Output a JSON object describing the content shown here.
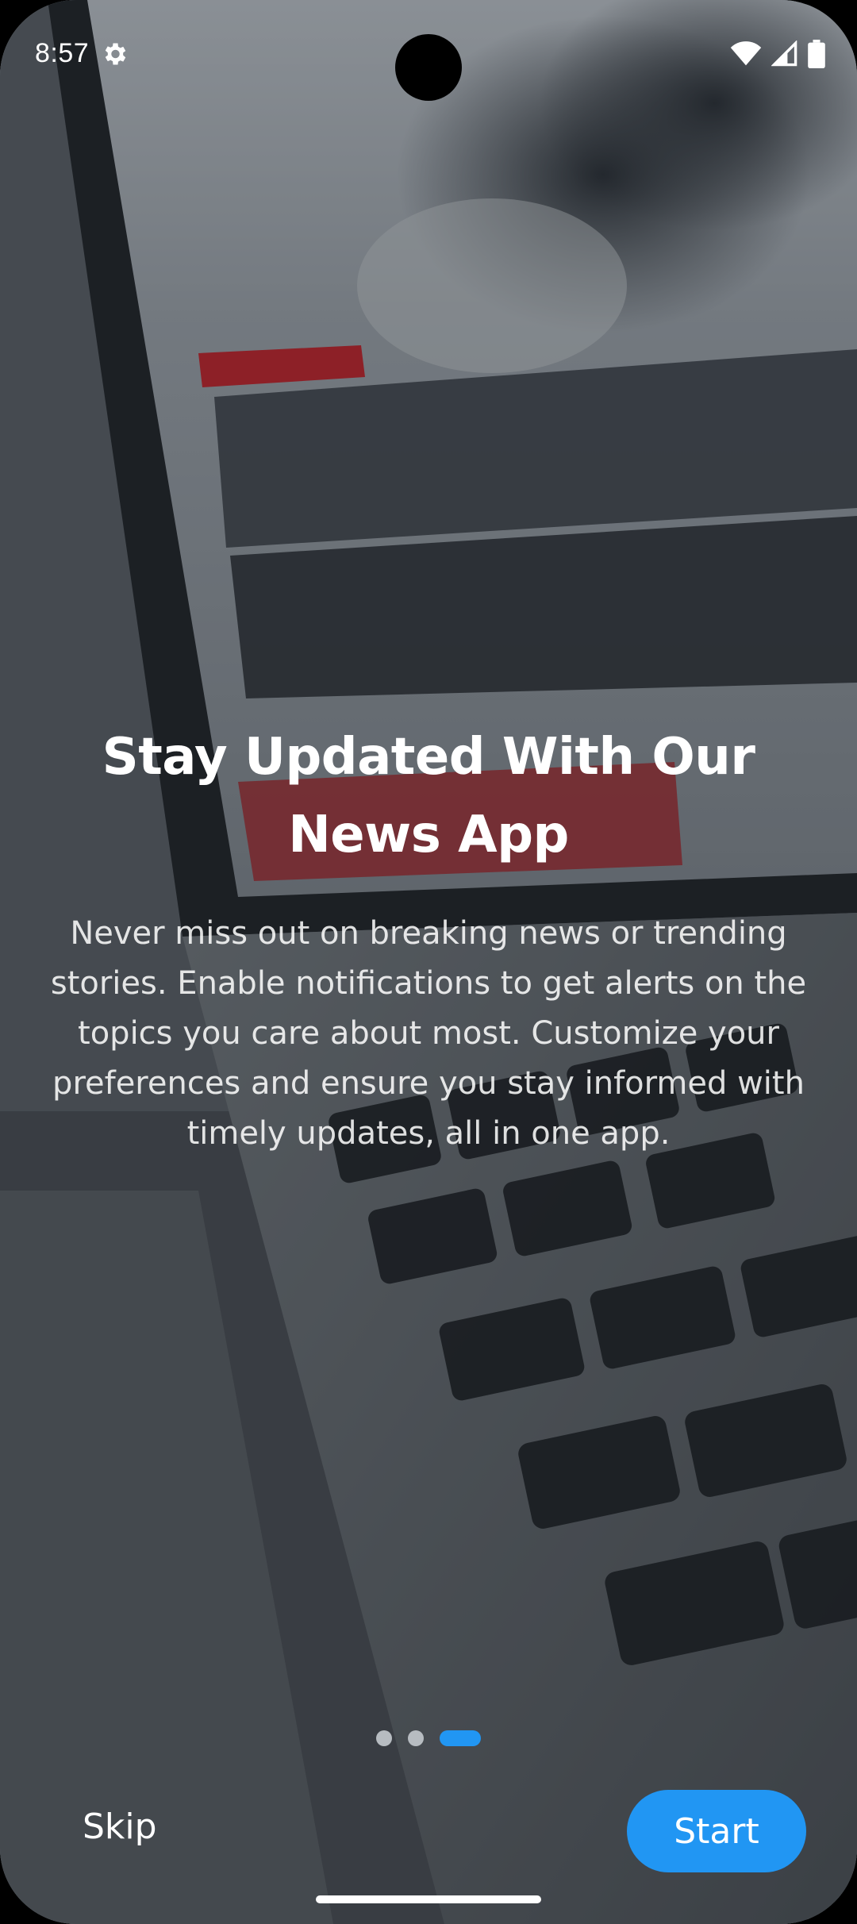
{
  "status_bar": {
    "time": "8:57",
    "icons": [
      "gear-icon",
      "wifi-icon",
      "signal-icon",
      "battery-icon"
    ]
  },
  "onboarding": {
    "title": "Stay Updated With Our News App",
    "description": "Never miss out on breaking news or trending stories. Enable notifications to get alerts on the topics you care about most. Customize your preferences and ensure you stay informed with timely updates, all in one app.",
    "page_count": 3,
    "current_page": 3
  },
  "actions": {
    "skip_label": "Skip",
    "start_label": "Start"
  },
  "colors": {
    "accent": "#2196f3",
    "inactive_dot": "#b7bcc1"
  }
}
